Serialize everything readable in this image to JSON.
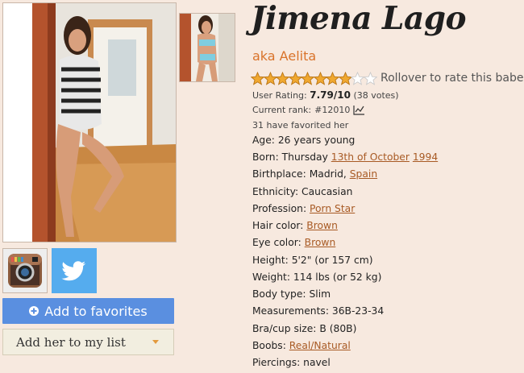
{
  "profile": {
    "name": "Jimena Lago",
    "alias": "aka Aelita",
    "rating": {
      "stars_filled": 8,
      "stars_total": 10,
      "hint": "Rollover to rate this babe",
      "label": "User Rating:",
      "value": "7.79/10",
      "votes": "(38 votes)"
    },
    "rank_label": "Current rank:",
    "rank_value": "#12010",
    "favorited": "31 have favorited her"
  },
  "details": {
    "age_label": "Age:",
    "age_value": "26 years young",
    "born_label": "Born:",
    "born_day": "Thursday",
    "born_date": "13th of October",
    "born_year": "1994",
    "birthplace_label": "Birthplace:",
    "birthplace_city": "Madrid,",
    "birthplace_country": "Spain",
    "ethnicity_label": "Ethnicity:",
    "ethnicity_value": "Caucasian",
    "profession_label": "Profession:",
    "profession_value": "Porn Star",
    "hair_label": "Hair color:",
    "hair_value": "Brown",
    "eye_label": "Eye color:",
    "eye_value": "Brown",
    "height_label": "Height:",
    "height_value": "5'2\" (or 157 cm)",
    "weight_label": "Weight:",
    "weight_value": "114 lbs (or 52 kg)",
    "body_label": "Body type:",
    "body_value": "Slim",
    "measurements_label": "Measurements:",
    "measurements_value": "36B-23-34",
    "bra_label": "Bra/cup size:",
    "bra_value": "B (80B)",
    "boobs_label": "Boobs:",
    "boobs_value": "Real/Natural",
    "piercings_label": "Piercings:",
    "piercings_value": "navel"
  },
  "buttons": {
    "add_favorites": "Add to favorites",
    "add_list": "Add her to my list"
  },
  "icons": {
    "instagram": "instagram-icon",
    "twitter": "twitter-icon",
    "favorite": "plus-circle-icon",
    "rank_chart": "chart-icon",
    "dropdown": "caret-down-icon"
  },
  "colors": {
    "background": "#f7e9df",
    "accent_orange": "#d9732a",
    "link": "#a85a24",
    "favorites_button": "#5a8fe0",
    "twitter_blue": "#55acee",
    "star_fill": "#f0a830"
  }
}
